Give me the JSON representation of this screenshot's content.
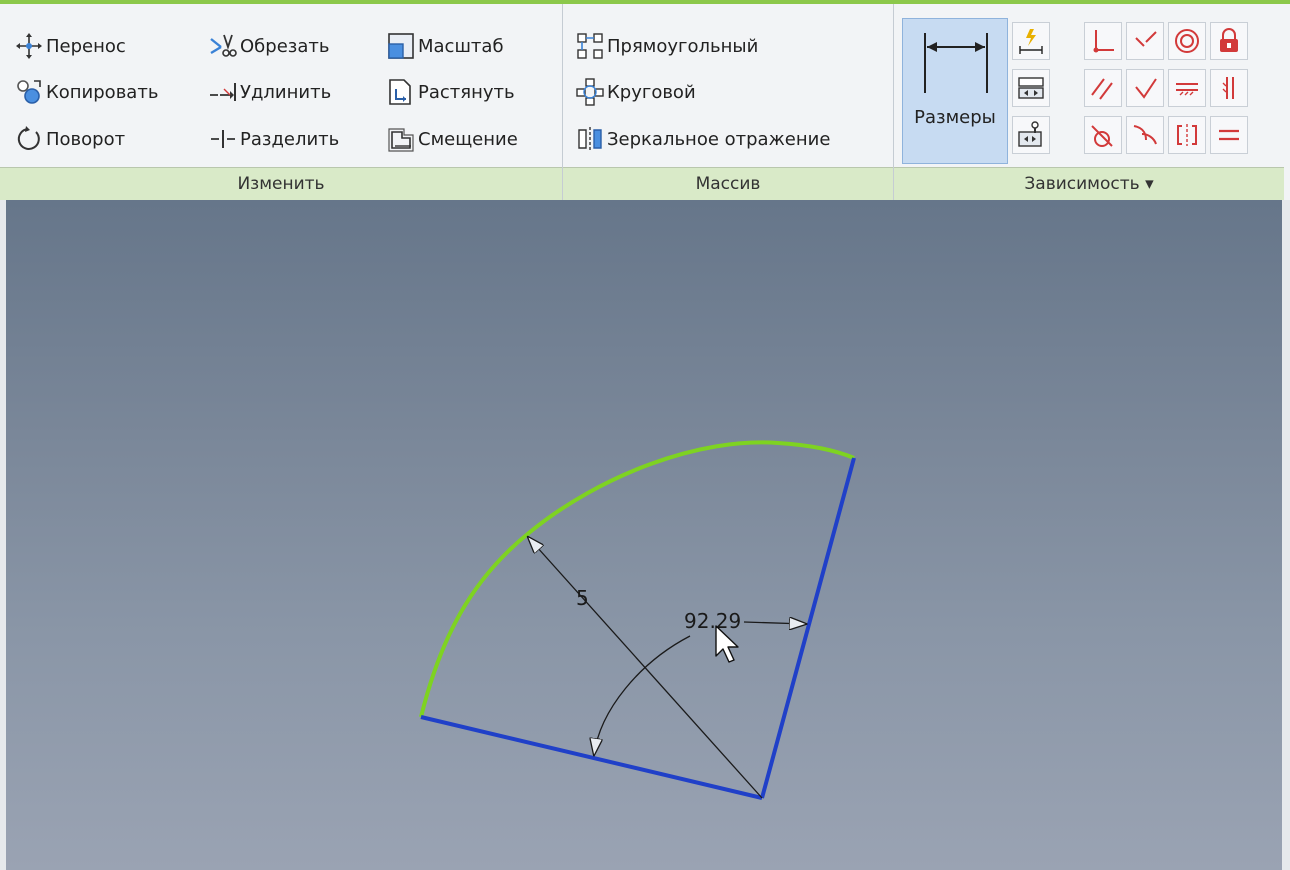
{
  "ribbon": {
    "modify": {
      "title": "Изменить",
      "tools": [
        {
          "label": "Перенос",
          "icon": "move-icon"
        },
        {
          "label": "Копировать",
          "icon": "copy-icon"
        },
        {
          "label": "Поворот",
          "icon": "rotate-icon"
        },
        {
          "label": "Обрезать",
          "icon": "trim-icon"
        },
        {
          "label": "Удлинить",
          "icon": "extend-icon"
        },
        {
          "label": "Разделить",
          "icon": "split-icon"
        },
        {
          "label": "Масштаб",
          "icon": "scale-icon"
        },
        {
          "label": "Растянуть",
          "icon": "stretch-icon"
        },
        {
          "label": "Смещение",
          "icon": "offset-icon"
        }
      ]
    },
    "pattern": {
      "title": "Массив",
      "tools": [
        {
          "label": "Прямоугольный",
          "icon": "rectangular-pattern-icon"
        },
        {
          "label": "Круговой",
          "icon": "circular-pattern-icon"
        },
        {
          "label": "Зеркальное отражение",
          "icon": "mirror-icon"
        }
      ]
    },
    "constrain": {
      "title": "Зависимость ▾",
      "dimension_label": "Размеры",
      "accent": "#d23a3a"
    }
  },
  "sketch": {
    "radius_label": "5",
    "angle_label": "92.29",
    "arc_color": "#7ed321",
    "line_color": "#2040c8"
  }
}
